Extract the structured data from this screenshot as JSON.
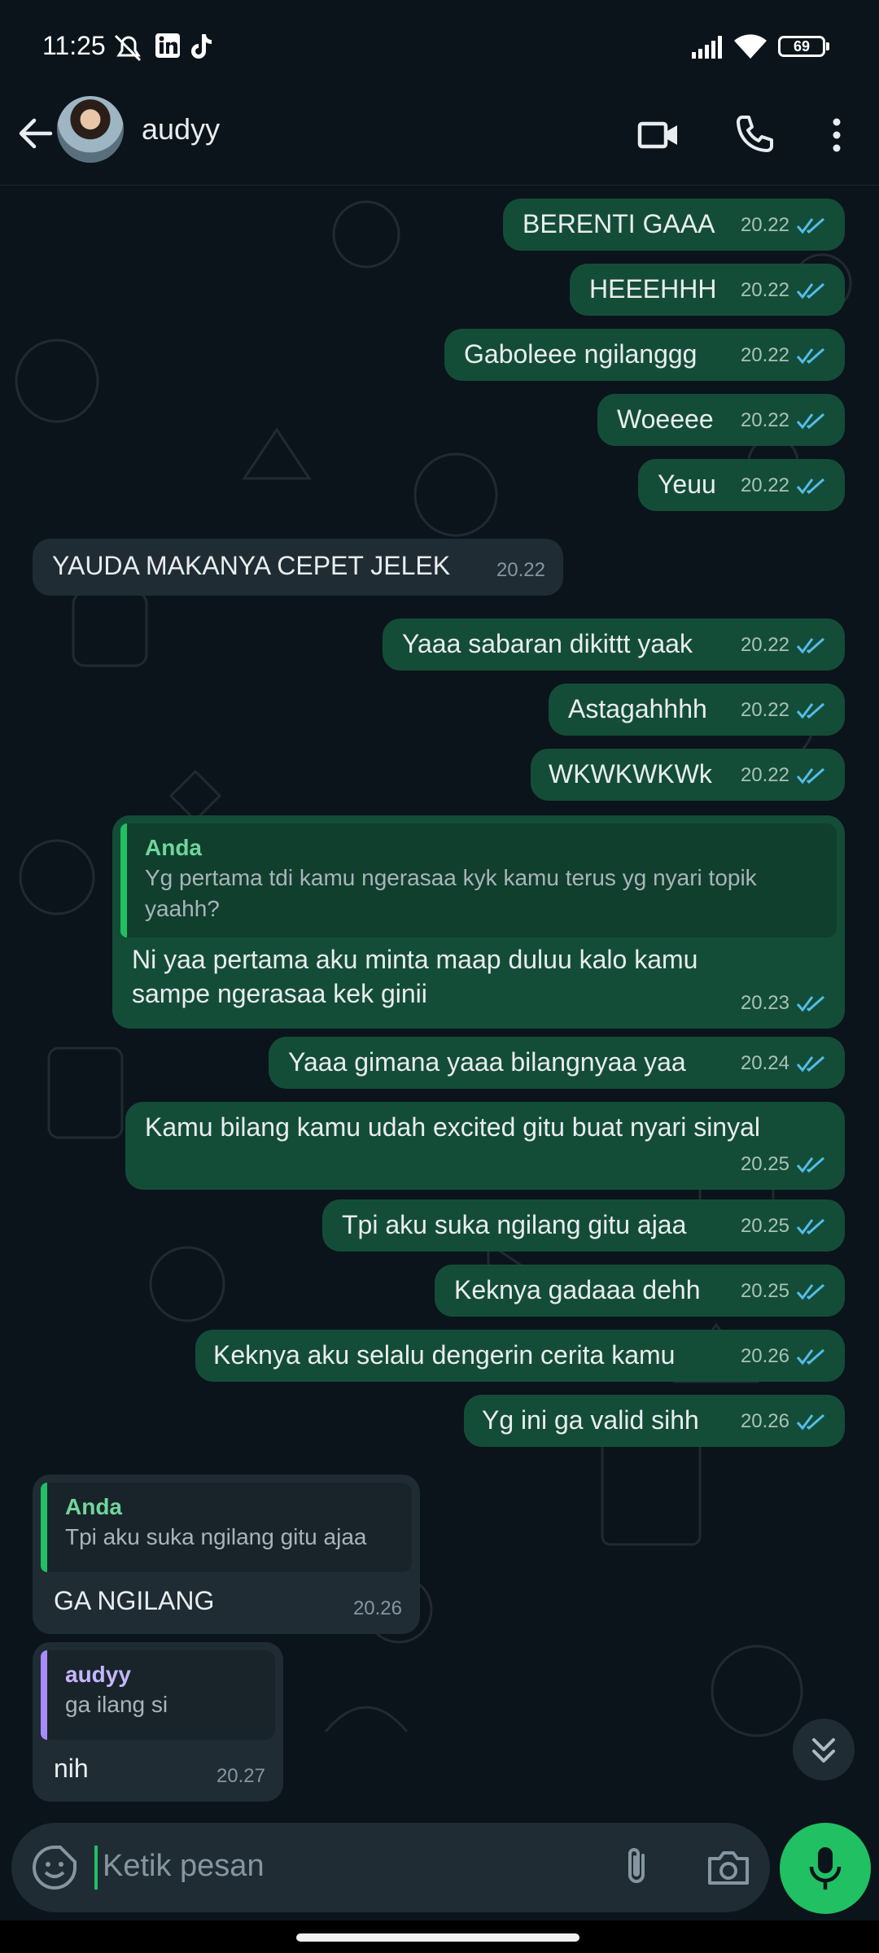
{
  "status_bar": {
    "time": "11:25",
    "battery": "69"
  },
  "header": {
    "contact_name": "audyy"
  },
  "messages": [
    {
      "text": "BERENTI GAAA",
      "time": "20.22"
    },
    {
      "text": "HEEEHHH",
      "time": "20.22"
    },
    {
      "text": "Gaboleee ngilanggg",
      "time": "20.22"
    },
    {
      "text": "Woeeee",
      "time": "20.22"
    },
    {
      "text": "Yeuu",
      "time": "20.22"
    },
    {
      "text": "YAUDA MAKANYA CEPET JELEK",
      "time": "20.22"
    },
    {
      "text": "Yaaa sabaran dikittt yaak",
      "time": "20.22"
    },
    {
      "text": "Astagahhhh",
      "time": "20.22"
    },
    {
      "text": "WKWKWKWk",
      "time": "20.22"
    },
    {
      "quote_author": "Anda",
      "quote_text": "Yg pertama tdi kamu ngerasaa kyk kamu terus yg nyari topik yaahh?",
      "line1": "Ni yaa pertama aku minta maap duluu kalo kamu",
      "line2": "sampe ngerasaa kek ginii",
      "time": "20.23"
    },
    {
      "text": "Yaaa gimana yaaa bilangnyaa yaa",
      "time": "20.24"
    },
    {
      "text": "Kamu bilang kamu udah excited gitu buat nyari sinyal",
      "time": "20.25"
    },
    {
      "text": "Tpi aku suka ngilang gitu ajaa",
      "time": "20.25"
    },
    {
      "text": "Keknya gadaaa dehh",
      "time": "20.25"
    },
    {
      "text": "Keknya aku selalu dengerin cerita kamu",
      "time": "20.26"
    },
    {
      "text": "Yg ini ga valid sihh",
      "time": "20.26"
    },
    {
      "quote_author": "Anda",
      "quote_text": "Tpi aku suka ngilang gitu ajaa",
      "text": "GA NGILANG",
      "time": "20.26"
    },
    {
      "quote_author": "audyy",
      "quote_text": "ga ilang si",
      "text": "nih",
      "time": "20.27"
    }
  ],
  "composer": {
    "placeholder": "Ketik pesan"
  },
  "colors": {
    "accent": "#21c063",
    "outgoing_bubble": "#144d37",
    "incoming_bubble": "#1f2c34",
    "background": "#0b141a",
    "read_ticks": "#53bdeb"
  }
}
